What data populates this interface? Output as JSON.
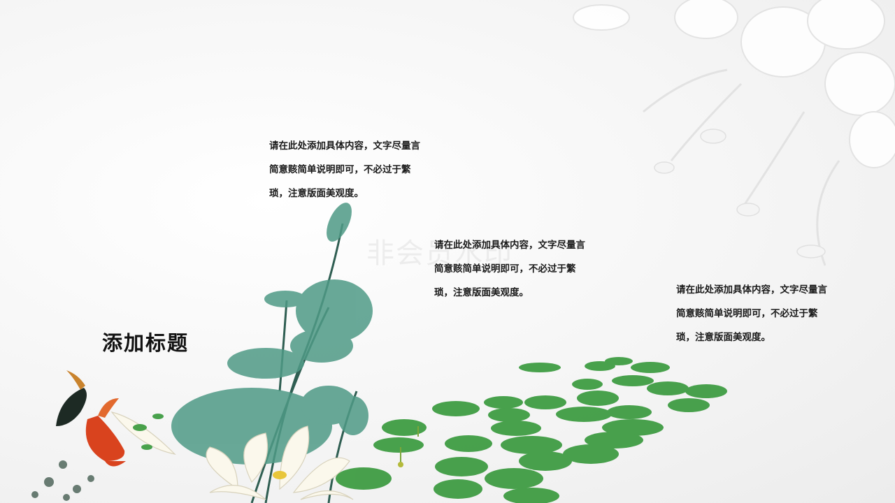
{
  "slide": {
    "title": "添加标题",
    "paragraphs": [
      "请在此处添加具体内容，文字尽量言简意赅简单说明即可，不必过于繁琐，注意版面美观度。",
      "请在此处添加具体内容，文字尽量言简意赅简单说明即可，不必过于繁琐，注意版面美观度。",
      "请在此处添加具体内容，文字尽量言简意赅简单说明即可，不必过于繁琐，注意版面美观度。"
    ],
    "watermark": "非会员水印"
  },
  "colors": {
    "lotus_leaf": "#3f8f7a",
    "lily_pad": "#3a9a3e",
    "koi_red": "#d9431e",
    "koi_dark": "#1d2a24"
  }
}
